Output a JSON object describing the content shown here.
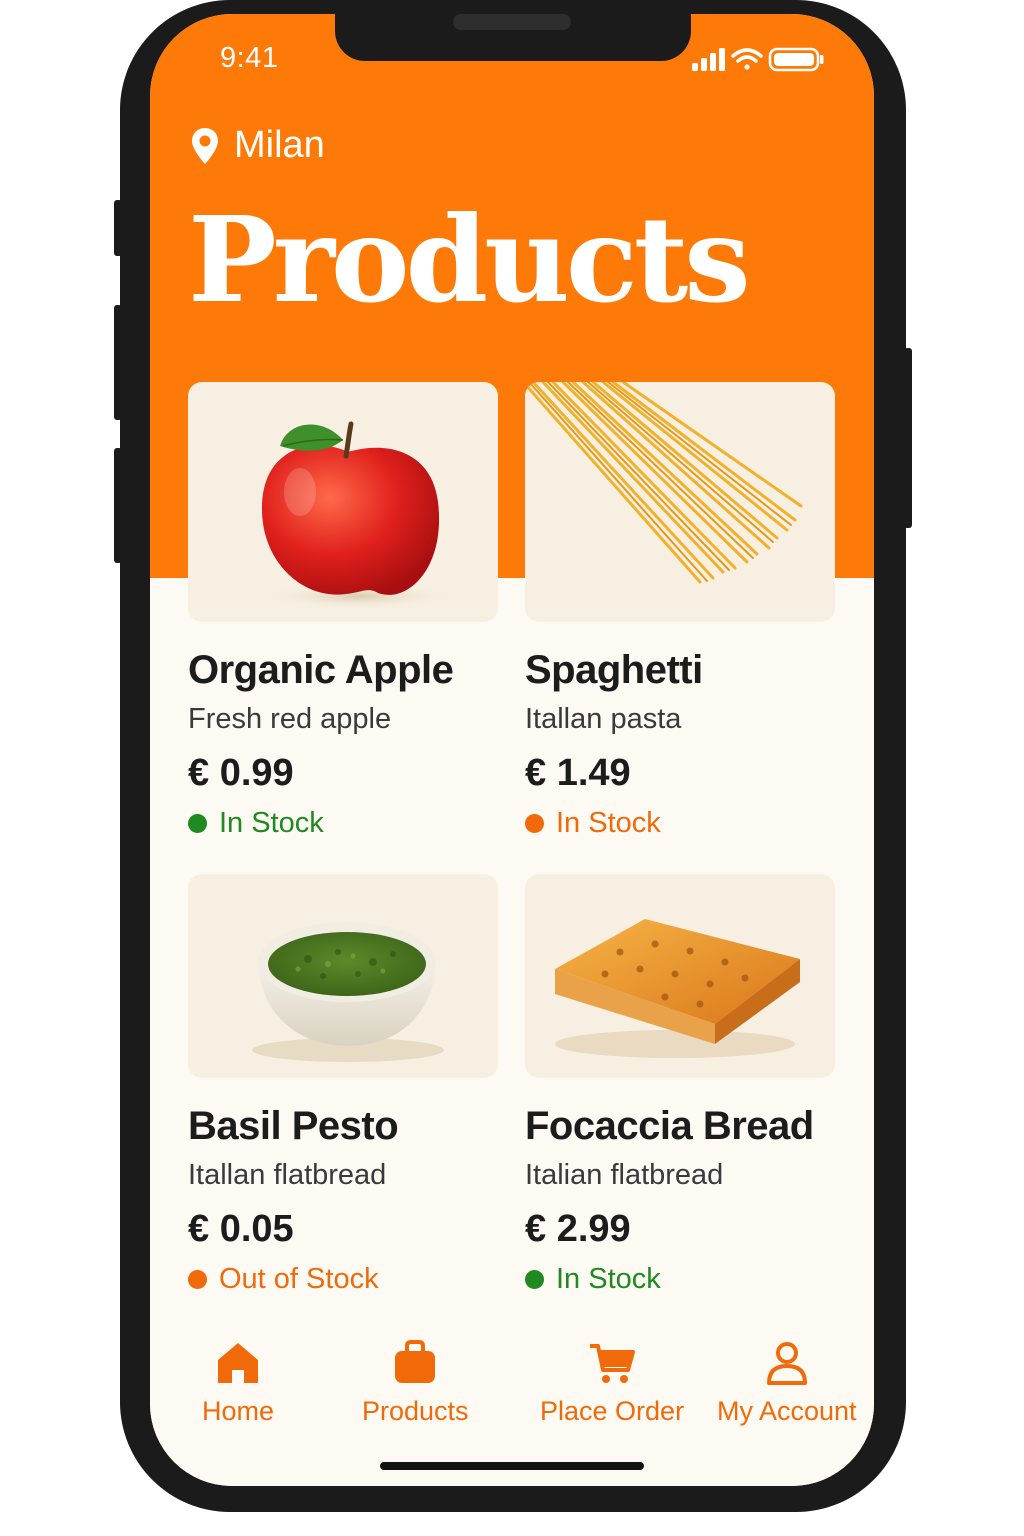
{
  "colors": {
    "accent": "#fe7a08",
    "in_stock_green": "#1f8a1f",
    "in_stock_orange": "#f06a0c",
    "out_of_stock": "#f06a0c"
  },
  "status_bar": {
    "time": "9:41"
  },
  "header": {
    "location_icon": "map-pin-icon",
    "location": "Milan",
    "title": "Products"
  },
  "products": [
    {
      "name": "Organic Apple",
      "description": "Fresh red apple",
      "price": "€ 0.99",
      "stock": "In Stock",
      "image": "apple"
    },
    {
      "name": "Spaghetti",
      "description": "Itallan pasta",
      "price": "€ 1.49",
      "stock": "In Stock",
      "image": "spaghetti"
    },
    {
      "name": "Basil Pesto",
      "description": "Itallan flatbread",
      "price": "€ 0.05",
      "stock": "Out of Stock",
      "image": "pesto-bowl"
    },
    {
      "name": "Focaccia Bread",
      "description": "Italian flatbread",
      "price": "€ 2.99",
      "stock": "In Stock",
      "image": "focaccia"
    }
  ],
  "tabbar": {
    "items": [
      {
        "label": "Home",
        "icon": "home-icon"
      },
      {
        "label": "Products",
        "icon": "bag-icon"
      },
      {
        "label": "Place Order",
        "icon": "cart-icon"
      },
      {
        "label": "My Account",
        "icon": "user-icon"
      }
    ]
  }
}
